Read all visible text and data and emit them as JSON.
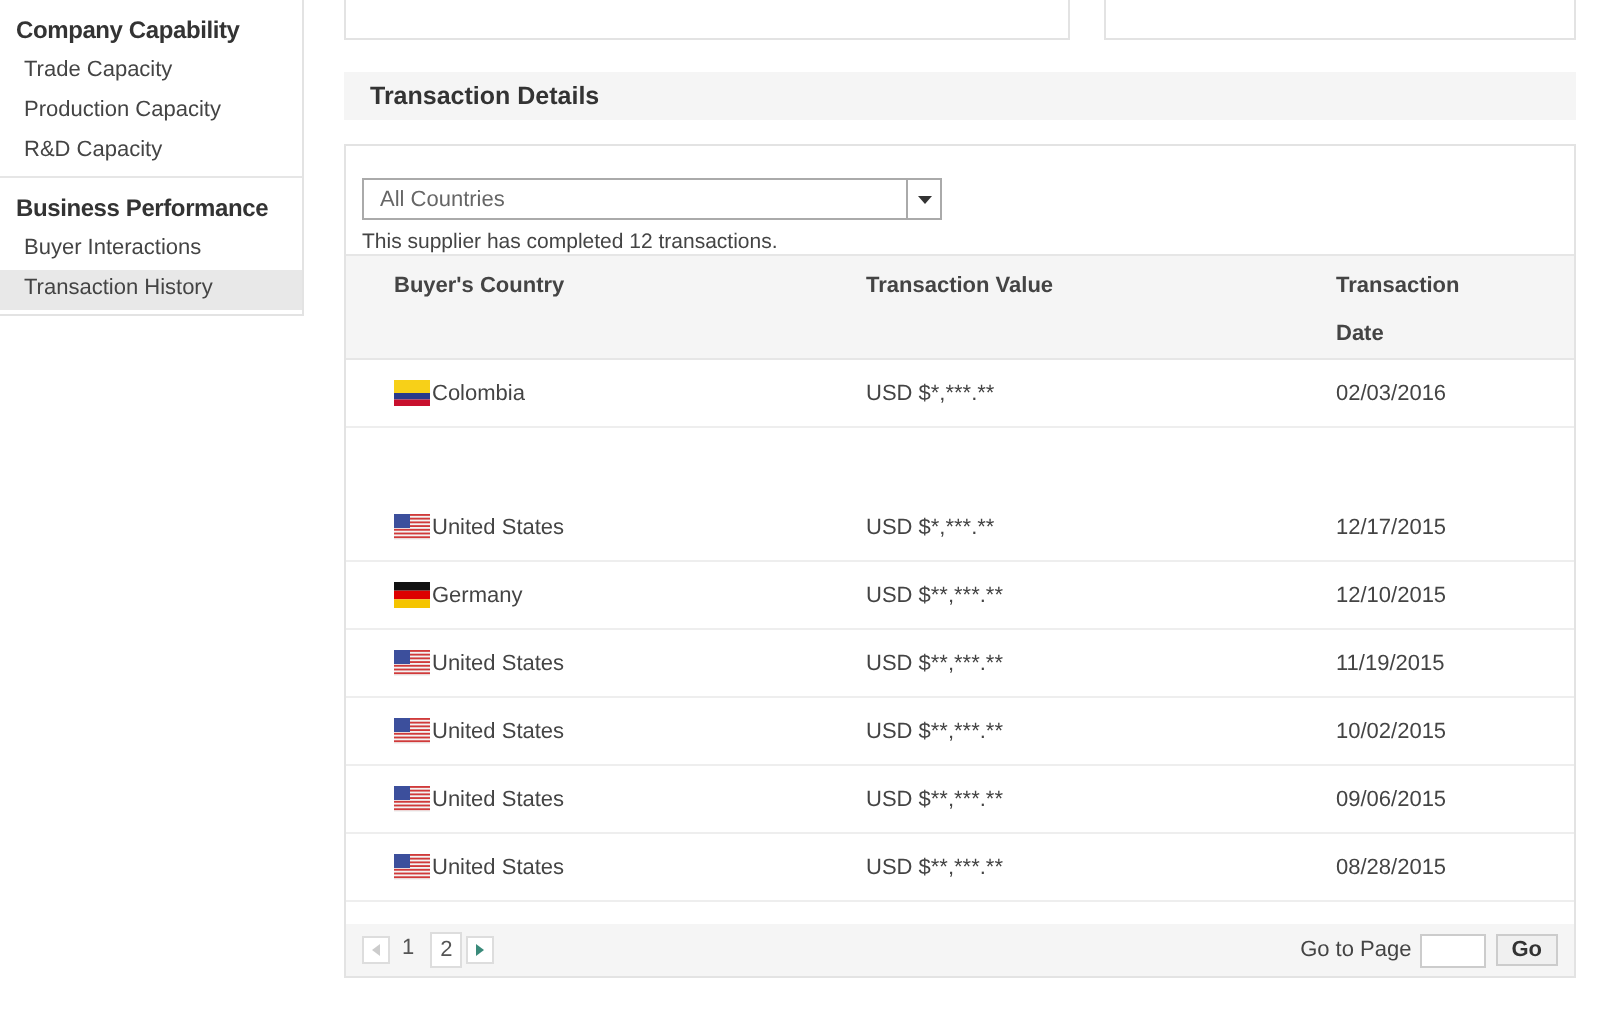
{
  "sidebar": {
    "sections": [
      {
        "title": "Company Capability",
        "items": [
          {
            "label": "Trade Capacity",
            "selected": false
          },
          {
            "label": "Production Capacity",
            "selected": false
          },
          {
            "label": "R&D Capacity",
            "selected": false
          }
        ]
      },
      {
        "title": "Business Performance",
        "items": [
          {
            "label": "Buyer Interactions",
            "selected": false
          },
          {
            "label": "Transaction History",
            "selected": true
          }
        ]
      }
    ]
  },
  "transaction_details": {
    "title": "Transaction Details",
    "country_filter": {
      "value": "All Countries"
    },
    "summary": "This supplier has completed 12 transactions.",
    "table": {
      "columns": [
        "Buyer's Country",
        "Transaction Value",
        "Transaction\nDate"
      ],
      "rows": [
        {
          "kind": "co",
          "country": "Colombia",
          "value": "USD $*,***.**",
          "date": "02/03/2016"
        },
        {
          "kind": "blank"
        },
        {
          "kind": "us",
          "country": "United States",
          "value": "USD $*,***.**",
          "date": "12/17/2015"
        },
        {
          "kind": "de",
          "country": "Germany",
          "value": "USD $**,***.**",
          "date": "12/10/2015"
        },
        {
          "kind": "us",
          "country": "United States",
          "value": "USD $**,***.**",
          "date": "11/19/2015"
        },
        {
          "kind": "us",
          "country": "United States",
          "value": "USD $**,***.**",
          "date": "10/02/2015"
        },
        {
          "kind": "us",
          "country": "United States",
          "value": "USD $**,***.**",
          "date": "09/06/2015"
        },
        {
          "kind": "us",
          "country": "United States",
          "value": "USD $**,***.**",
          "date": "08/28/2015"
        }
      ]
    },
    "pagination": {
      "pages": [
        {
          "label": "1",
          "selected": true
        },
        {
          "label": "2",
          "selected": false
        }
      ],
      "go_to_label": "Go to Page",
      "go_button": "Go"
    }
  }
}
